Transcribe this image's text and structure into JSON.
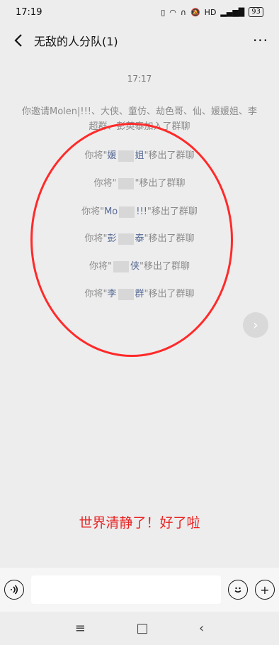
{
  "status_bar": {
    "time": "17:19",
    "icons": [
      "sim-icon",
      "hotspot-icon",
      "headphone-icon",
      "mute-icon",
      "hd-icon",
      "signal-icon"
    ],
    "battery": "93"
  },
  "header": {
    "title": "无敌的人分队(1)",
    "back_icon": "chevron-left",
    "more_icon": "more-dots"
  },
  "chat": {
    "timestamp": "17:17",
    "invite_prefix": "你邀请",
    "invite_link": "Molen|!!!、大侠、童仿、劫色哥、仙、媛媛姐、李超群、彭英泰",
    "invite_suffix": "加入了群聊",
    "removals": [
      {
        "before": "你将\"",
        "name_visible": "媛",
        "name_tail": "姐",
        "after": "\"移出了群聊"
      },
      {
        "before": "你将\"",
        "name_visible": "",
        "name_tail": "",
        "after": "\"移出了群聊"
      },
      {
        "before": "你将\"",
        "name_visible": "Mo",
        "name_tail": "!!!",
        "after": "\"移出了群聊"
      },
      {
        "before": "你将\"",
        "name_visible": "彭",
        "name_tail": "泰",
        "after": "\"移出了群聊"
      },
      {
        "before": "你将\"",
        "name_visible": "",
        "name_tail": "侠",
        "after": "\"移出了群聊"
      },
      {
        "before": "你将\"",
        "name_visible": "李",
        "name_tail": "群",
        "after": "\"移出了群聊"
      }
    ]
  },
  "annotation": "世界清静了！好了啦",
  "input": {
    "placeholder": ""
  },
  "colors": {
    "background": "#ededed",
    "annotation_red": "#e82222",
    "link_blue": "#576b95"
  }
}
